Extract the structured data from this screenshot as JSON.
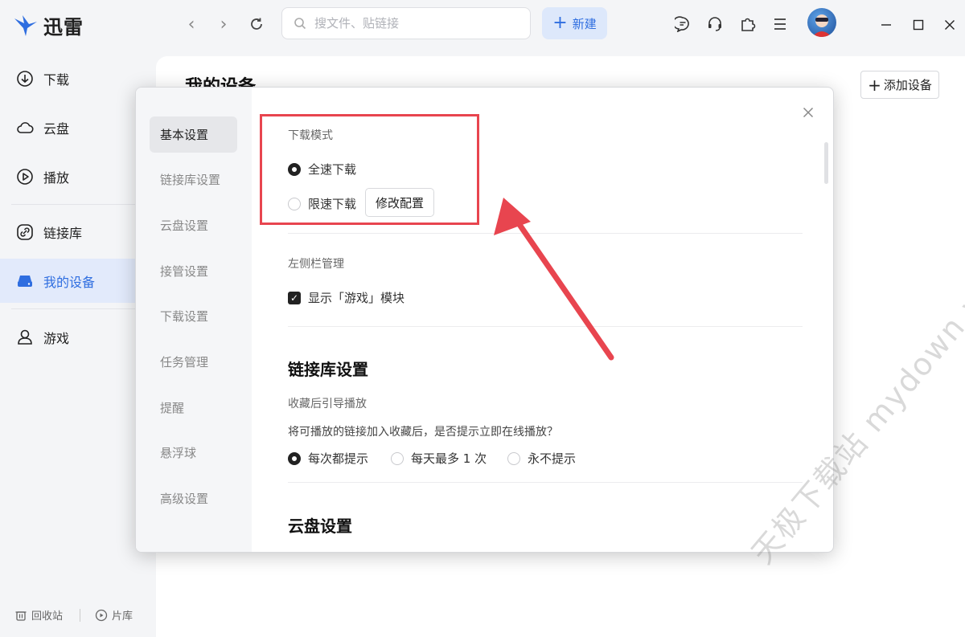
{
  "app": {
    "name": "迅雷"
  },
  "toolbar": {
    "search_placeholder": "搜文件、贴链接",
    "new_label": "新建"
  },
  "sidebar": {
    "items": [
      {
        "label": "下载"
      },
      {
        "label": "云盘"
      },
      {
        "label": "播放"
      },
      {
        "label": "链接库"
      },
      {
        "label": "我的设备"
      },
      {
        "label": "游戏"
      }
    ],
    "footer": {
      "recycle_label": "回收站",
      "library_label": "片库"
    }
  },
  "main": {
    "title": "我的设备",
    "add_device_label": "添加设备"
  },
  "settings_dialog": {
    "nav": [
      "基本设置",
      "链接库设置",
      "云盘设置",
      "接管设置",
      "下载设置",
      "任务管理",
      "提醒",
      "悬浮球",
      "高级设置"
    ],
    "download_mode": {
      "label": "下载模式",
      "option_full": "全速下载",
      "option_limited": "限速下载",
      "modify_button": "修改配置"
    },
    "sidebar_management": {
      "label": "左侧栏管理",
      "show_games": "显示「游戏」模块"
    },
    "link_library": {
      "section_title": "链接库设置",
      "label": "收藏后引导播放",
      "question": "将可播放的链接加入收藏后，是否提示立即在线播放？",
      "option_always": "每次都提示",
      "option_daily": "每天最多 1 次",
      "option_never": "永不提示"
    },
    "cloud": {
      "section_title": "云盘设置"
    }
  },
  "watermark": "天极下载站 mydown.yesky.com",
  "colors": {
    "accent": "#2f6ee0",
    "highlight_red": "#e8454f"
  }
}
